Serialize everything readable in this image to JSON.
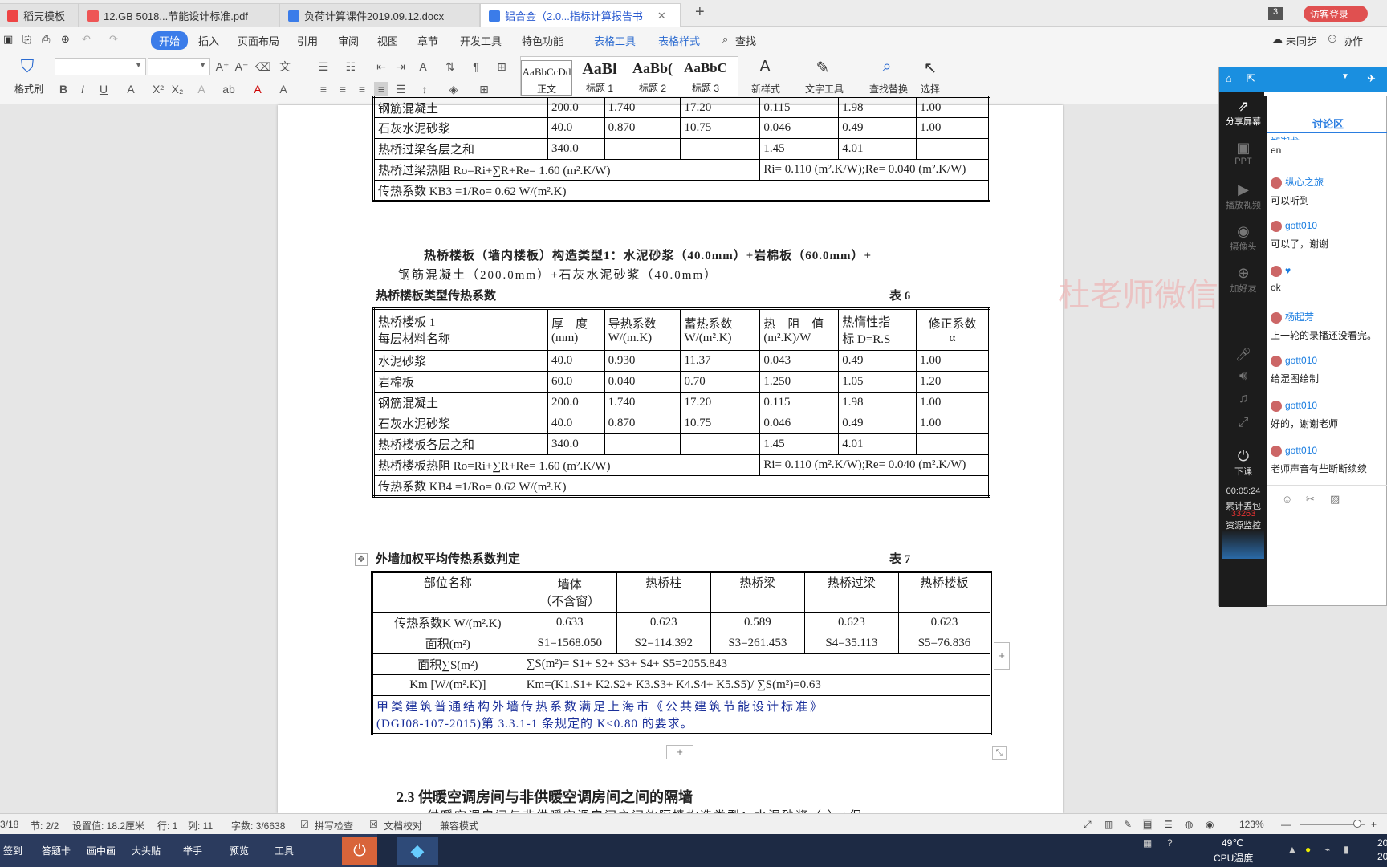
{
  "tabs": [
    {
      "label": "稻壳模板"
    },
    {
      "label": "12.GB 5018...节能设计标准.pdf"
    },
    {
      "label": "负荷计算课件2019.09.12.docx"
    },
    {
      "label": "铝合金（2.0...指标计算报告书"
    }
  ],
  "tab_bar": {
    "count_badge": "3",
    "login": "访客登录"
  },
  "menu": {
    "items": [
      "开始",
      "插入",
      "页面布局",
      "引用",
      "审阅",
      "视图",
      "章节",
      "开发工具",
      "特色功能",
      "表格工具",
      "表格样式",
      "查找"
    ],
    "sync": "未同步",
    "collab": "协作"
  },
  "ribbon": {
    "format_painter": "格式刷",
    "styles": [
      {
        "sample": "AaBbCcDd",
        "name": "正文"
      },
      {
        "sample": "AaBl",
        "name": "标题 1"
      },
      {
        "sample": "AaBb(",
        "name": "标题 2"
      },
      {
        "sample": "AaBbC",
        "name": "标题 3"
      }
    ],
    "new_style": "新样式",
    "text_tools": "文字工具",
    "find_replace": "查找替换",
    "select": "选择"
  },
  "doc": {
    "t5": {
      "rows": [
        [
          "钢筋混凝土",
          "200.0",
          "1.740",
          "17.20",
          "0.115",
          "1.98",
          "1.00"
        ],
        [
          "石灰水泥砂浆",
          "40.0",
          "0.870",
          "10.75",
          "0.046",
          "0.49",
          "1.00"
        ],
        [
          "热桥过梁各层之和",
          "340.0",
          "",
          "",
          "1.45",
          "4.01",
          ""
        ]
      ],
      "r_row": "热桥过梁热阻 Ro=Ri+∑R+Re= 1.60 (m².K/W)",
      "r_row2": "Ri= 0.110 (m².K/W);Re= 0.040 (m².K/W)",
      "k_row": "传热系数  KB3 =1/Ro= 0.62 W/(m².K)"
    },
    "heading1": "热桥楼板（墙内楼板）构造类型1：水泥砂浆（40.0mm）+岩棉板（60.0mm）+",
    "heading1b": "钢筋混凝土（200.0mm）+石灰水泥砂浆（40.0mm）",
    "t6_caption": "热桥楼板类型传热系数",
    "t6_no": "表 6",
    "t6": {
      "header": [
        "热桥楼板 1\n每层材料名称",
        "厚　度\n(mm)",
        "导热系数\nW/(m.K)",
        "蓄热系数\nW/(m².K)",
        "热　阻　值\n(m².K)/W",
        "热惰性指\n标 D=R.S",
        "修正系数\nα"
      ],
      "rows": [
        [
          "水泥砂浆",
          "40.0",
          "0.930",
          "11.37",
          "0.043",
          "0.49",
          "1.00"
        ],
        [
          "岩棉板",
          "60.0",
          "0.040",
          "0.70",
          "1.250",
          "1.05",
          "1.20"
        ],
        [
          "钢筋混凝土",
          "200.0",
          "1.740",
          "17.20",
          "0.115",
          "1.98",
          "1.00"
        ],
        [
          "石灰水泥砂浆",
          "40.0",
          "0.870",
          "10.75",
          "0.046",
          "0.49",
          "1.00"
        ],
        [
          "热桥楼板各层之和",
          "340.0",
          "",
          "",
          "1.45",
          "4.01",
          ""
        ]
      ],
      "r_row": "热桥楼板热阻 Ro=Ri+∑R+Re= 1.60 (m².K/W)",
      "r_row2": "Ri= 0.110 (m².K/W);Re= 0.040 (m².K/W)",
      "k_row": "传热系数  KB4 =1/Ro= 0.62 W/(m².K)"
    },
    "t7_caption": "外墙加权平均传热系数判定",
    "t7_no": "表 7",
    "t7": {
      "header": [
        "部位名称",
        "墙体\n（不含窗）",
        "热桥柱",
        "热桥梁",
        "热桥过梁",
        "热桥楼板"
      ],
      "k_label": "传热系数K W/(m².K)",
      "k_values": [
        "0.633",
        "0.623",
        "0.589",
        "0.623",
        "0.623"
      ],
      "area_label": "面积(m²)",
      "area_values": [
        "S1=1568.050",
        "S2=114.392",
        "S3=261.453",
        "S4=35.113",
        "S5=76.836"
      ],
      "sum_label": "面积∑S(m²)",
      "sum_value": "∑S(m²)= S1+ S2+ S3+ S4+ S5=2055.843",
      "km_label": "Km [W/(m².K)]",
      "km_value": "Km=(K1.S1+ K2.S2+ K3.S3+ K4.S4+ K5.S5)/ ∑S(m²)=0.63",
      "conclusion1": "甲类建筑普通结构外墙传热系数满足上海市《公共建筑节能设计标准》",
      "conclusion2": "(DGJ08-107-2015)第 3.3.1-1 条规定的 K≤0.80 的要求。"
    },
    "section": "2.3  供暖空调房间与非供暖空调房间之间的隔墙",
    "section_next": "供暖空调房间与非供暖空调房间之间的隔墙构造类型：水泥砂浆（ ）+保"
  },
  "watermark": "杜老师微信 836667",
  "side": {
    "tab": "讨论区",
    "nav": [
      "分享屏幕",
      "PPT",
      "播放视频",
      "摄像头",
      "加好友"
    ],
    "messages": [
      {
        "user": "郑潮龙",
        "text": "en"
      },
      {
        "user": "纵心之旅",
        "text": "可以听到"
      },
      {
        "user": "gott010",
        "text": "可以了，谢谢"
      },
      {
        "user": "♥",
        "text": "ok"
      },
      {
        "user": "杨起芳",
        "text": "上一轮的录播还没看完。"
      },
      {
        "user": "gott010",
        "text": "给湿图绘制"
      },
      {
        "user": "gott010",
        "text": "好的，谢谢老师"
      },
      {
        "user": "gott010",
        "text": "老师声音有些断断续续"
      }
    ],
    "leave": "下课",
    "timer": "00:05:24",
    "stat1": "累计丢包",
    "stat2": "33263",
    "stat3": "资源监控"
  },
  "status": {
    "page": "3/18",
    "section": "节: 2/2",
    "setting": "设置值: 18.2厘米",
    "row": "行: 1",
    "col": "列: 11",
    "words": "字数: 3/6638",
    "spell": "拼写检查",
    "proof": "文档校对",
    "compat": "兼容模式",
    "zoom": "123%"
  },
  "taskbar": {
    "items": [
      "签到",
      "答题卡",
      "画中画",
      "大头贴",
      "举手",
      "预览",
      "工具"
    ],
    "temp": "49℃",
    "temp_label": "CPU温度",
    "time": "20",
    "date": "20"
  }
}
